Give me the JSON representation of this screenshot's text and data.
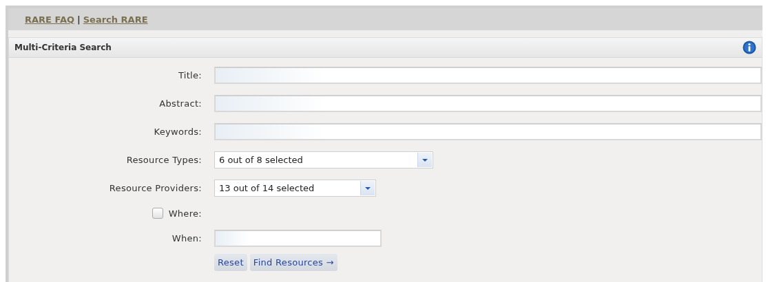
{
  "nav_links": [
    {
      "label": "RARE FAQ"
    },
    {
      "label": "Search RARE"
    }
  ],
  "nav_separator": "|",
  "panel": {
    "title": "Multi-Criteria Search"
  },
  "fields": [
    {
      "kind": "text",
      "label": "Title:"
    },
    {
      "kind": "text",
      "label": "Abstract:"
    },
    {
      "kind": "text",
      "label": "Keywords:"
    },
    {
      "kind": "select",
      "label": "Resource Types:",
      "value": "6 out of 8 selected"
    },
    {
      "kind": "select",
      "label": "Resource Providers:",
      "value": "13 out of 14 selected"
    },
    {
      "kind": "checkbox",
      "label": "Where:",
      "checked": false
    },
    {
      "kind": "text",
      "label": "When:"
    }
  ],
  "buttons": [
    "Reset",
    "Find Resources →"
  ]
}
